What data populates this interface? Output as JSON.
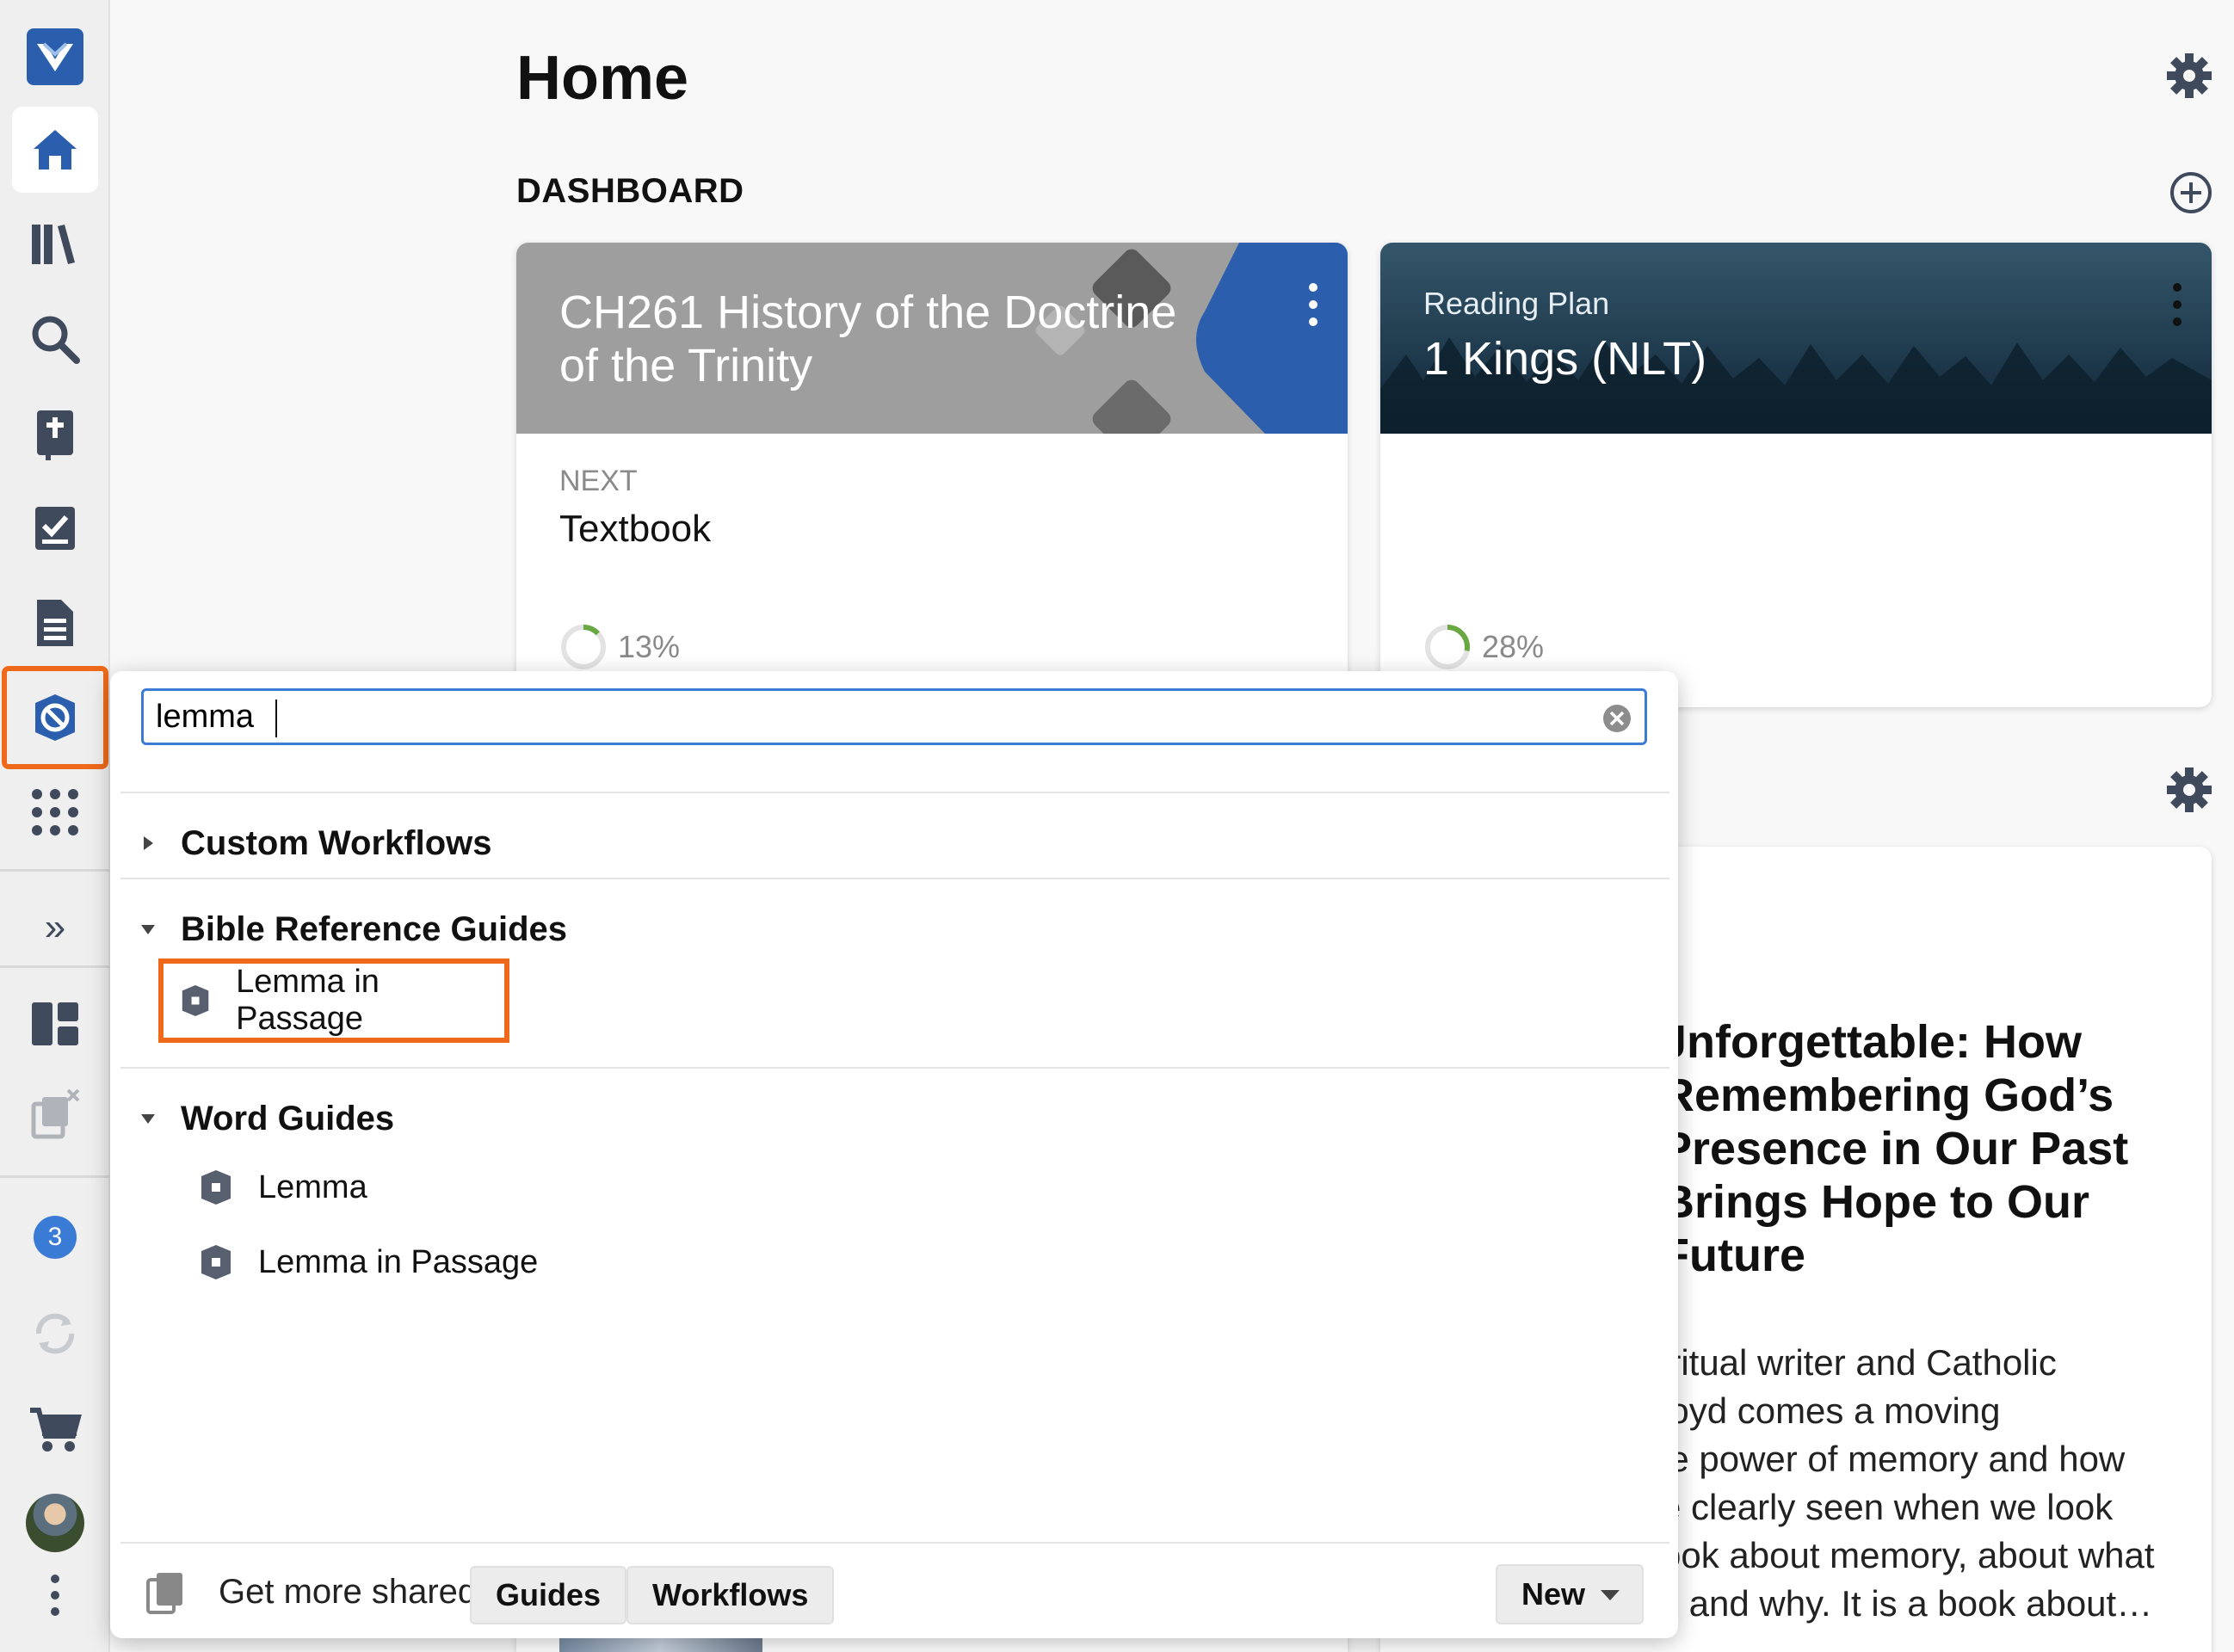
{
  "app": {
    "accent": "#2b5fad",
    "highlight": "#ee6a1a"
  },
  "rail": {
    "items": [
      {
        "name": "app-logo-icon"
      },
      {
        "name": "home-icon"
      },
      {
        "name": "library-icon"
      },
      {
        "name": "search-icon"
      },
      {
        "name": "bible-icon"
      },
      {
        "name": "tasks-icon"
      },
      {
        "name": "documents-icon"
      },
      {
        "name": "guides-icon"
      },
      {
        "name": "apps-grid-icon"
      },
      {
        "name": "expand-icon"
      },
      {
        "name": "layouts-icon"
      },
      {
        "name": "close-panels-icon"
      },
      {
        "name": "notifications"
      },
      {
        "name": "sync-icon"
      },
      {
        "name": "cart-icon"
      },
      {
        "name": "avatar"
      },
      {
        "name": "more-icon"
      }
    ],
    "expand_glyph": "»",
    "notification_count": "3"
  },
  "home": {
    "title": "Home",
    "dashboard_label": "DASHBOARD",
    "course_card": {
      "title_line1": "CH261 History of the Doctrine",
      "title_line2": "of the Trinity",
      "next_label": "NEXT",
      "next_value": "Textbook",
      "progress_text": "13%",
      "progress": 0.13
    },
    "plan_card": {
      "kicker": "Reading Plan",
      "title": "1 Kings (NLT)",
      "progress_text": "28%",
      "progress": 0.28
    },
    "article": {
      "title_lines": [
        "Jnforgettable: How",
        "Remembering God’s",
        "Presence in Our Past",
        "Brings Hope to Our",
        "Future"
      ],
      "body_lines": [
        "iritual writer and Catholic",
        "loyd comes a moving",
        "ie power of memory and how",
        "e clearly seen when we look",
        "ook about memory, about what",
        "l, and why. It is a book about…"
      ]
    }
  },
  "panel": {
    "search": {
      "value": "lemma",
      "placeholder": ""
    },
    "sections": [
      {
        "title": "Custom Workflows",
        "expanded": false,
        "items": []
      },
      {
        "title": "Bible Reference Guides",
        "expanded": true,
        "items": [
          {
            "label": "Lemma in Passage",
            "selected": true
          }
        ]
      },
      {
        "title": "Word Guides",
        "expanded": true,
        "items": [
          {
            "label": "Lemma",
            "selected": false
          },
          {
            "label": "Lemma in Passage",
            "selected": false
          }
        ]
      }
    ],
    "footer": {
      "label": "Get more shared:",
      "guides_button": "Guides",
      "workflows_button": "Workflows",
      "sort_value": "New"
    }
  }
}
